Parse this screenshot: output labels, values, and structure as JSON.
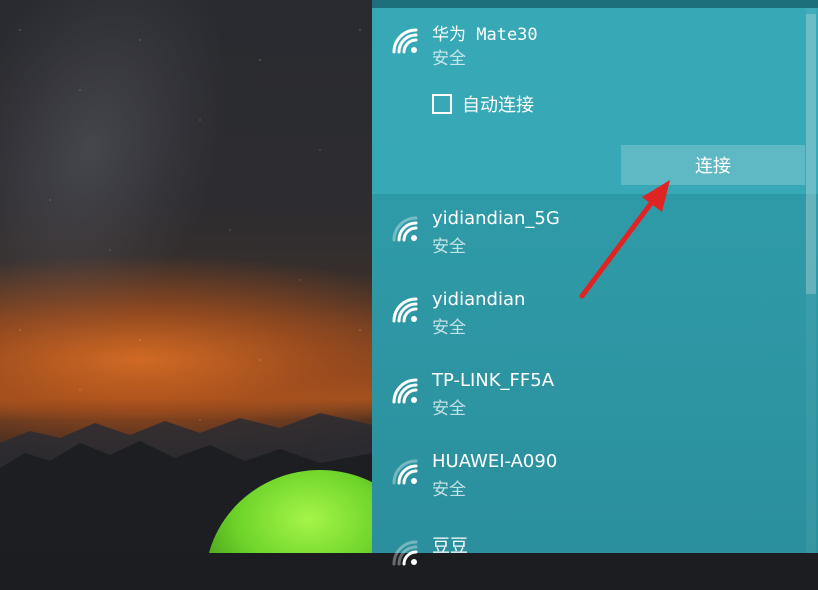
{
  "flyout": {
    "selected_network": {
      "name": "华为 Mate30",
      "status": "安全",
      "auto_connect_label": "自动连接",
      "auto_connect_checked": false,
      "connect_label": "连接"
    },
    "networks": [
      {
        "name": "yidiandian_5G",
        "status": "安全"
      },
      {
        "name": "yidiandian",
        "status": "安全"
      },
      {
        "name": "TP-LINK_FF5A",
        "status": "安全"
      },
      {
        "name": "HUAWEI-A090",
        "status": "安全"
      },
      {
        "name": "豆豆",
        "status": ""
      }
    ]
  },
  "icons": [
    "wifi-signal-icon",
    "red-annotation-arrow"
  ],
  "colors": {
    "flyout_bg": "#2f9aa7",
    "expanded_bg": "#37a8b6",
    "annotation_arrow": "#e02424"
  }
}
